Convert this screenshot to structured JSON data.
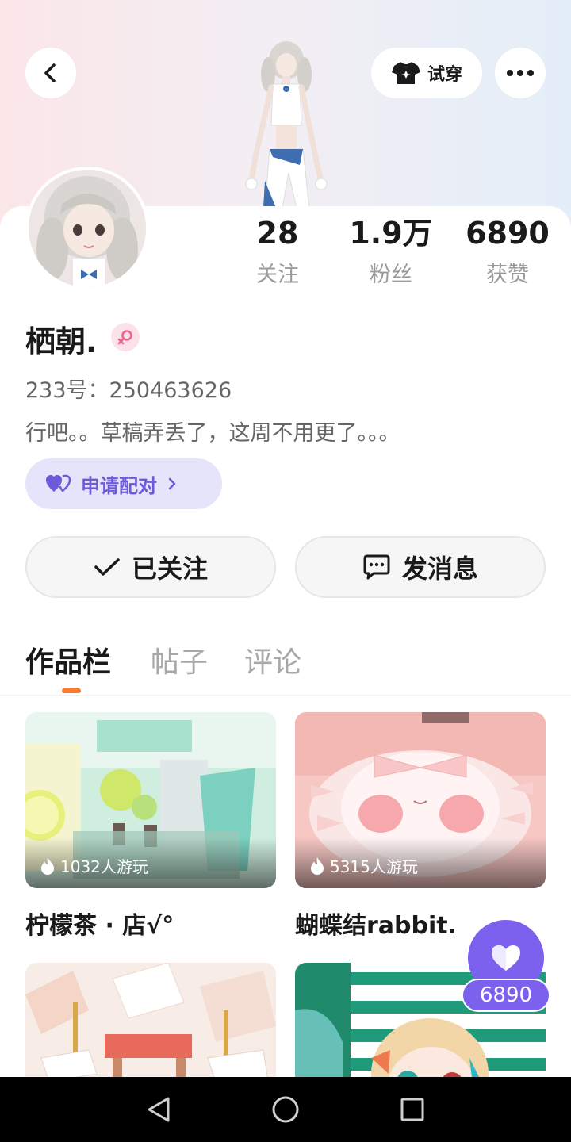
{
  "header": {
    "tryon_label": "试穿"
  },
  "stats": [
    {
      "value": "28",
      "label": "关注"
    },
    {
      "value": "1.9万",
      "label": "粉丝"
    },
    {
      "value": "6890",
      "label": "获赞"
    }
  ],
  "profile": {
    "name": "栖朝.",
    "uid": "233号：250463626",
    "bio": "行吧。。草稿弄丢了，这周不用更了。。。",
    "gender_icon": "female-icon"
  },
  "pair_button": {
    "label": "申请配对"
  },
  "actions": {
    "follow_label": "已关注",
    "message_label": "发消息"
  },
  "tabs": [
    {
      "label": "作品栏",
      "active": true
    },
    {
      "label": "帖子",
      "active": false
    },
    {
      "label": "评论",
      "active": false
    }
  ],
  "works": [
    {
      "title": "柠檬茶 · 店√°",
      "plays": "1032人游玩"
    },
    {
      "title": "蝴蝶结rabbit.",
      "plays": "5315人游玩"
    },
    {
      "title": "",
      "plays": ""
    },
    {
      "title": "",
      "plays": ""
    }
  ],
  "likes": {
    "count": "6890"
  },
  "colors": {
    "accent": "#7b61ee",
    "tab_indicator": "#ff7a2a",
    "pair_bg": "#e6e4fb"
  }
}
